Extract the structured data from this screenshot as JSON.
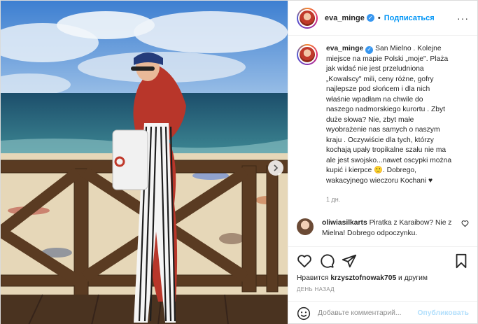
{
  "header": {
    "username": "eva_minge",
    "follow_label": "Подписаться",
    "separator": "•",
    "more": "···"
  },
  "caption": {
    "username": "eva_minge",
    "body": "San Mielno . Kolejne\nmiejsce na mapie Polski „moje\". Plaża\njak widać nie jest przeludniona\n„Kowalscy\" mili, ceny różne, gofry\nnajlepsze pod słońcem i dla nich\nwłaśnie wpadłam na chwile do\nnaszego nadmorskiego kurortu . Zbyt\nduże słowa? Nie, zbyt małe\nwyobrażenie nas samych o naszym\nkraju . Oczywiście dla tych, którzy\nkochają upały tropikalne szału nie ma\nale jest swojsko...nawet oscypki można\nkupić i kierpce 🙂. Dobrego,\nwakacyjnego wieczoru Kochani ♥",
    "age": "1 дн."
  },
  "comment": {
    "username": "oliwiasilkarts",
    "text": "Piratka z Karaibow? Nie z Mielna! Dobrego odpoczynku."
  },
  "likes": {
    "prefix": "Нравится",
    "user": "krzysztofnowak705",
    "suffix": "и другим"
  },
  "date": "ДЕНЬ НАЗАД",
  "add_comment": {
    "placeholder": "Добавьте комментарий...",
    "publish_label": "Опубликовать"
  },
  "icons": {
    "verified": "verified-badge",
    "like": "heart-icon",
    "comment": "comment-icon",
    "share": "share-icon",
    "save": "bookmark-icon",
    "emoji": "emoji-icon",
    "next": "chevron-right-icon"
  },
  "colors": {
    "accent": "#0095f6",
    "verified": "#3897f0",
    "muted": "#8e8e8e",
    "publish_disabled": "#b2dffc"
  }
}
